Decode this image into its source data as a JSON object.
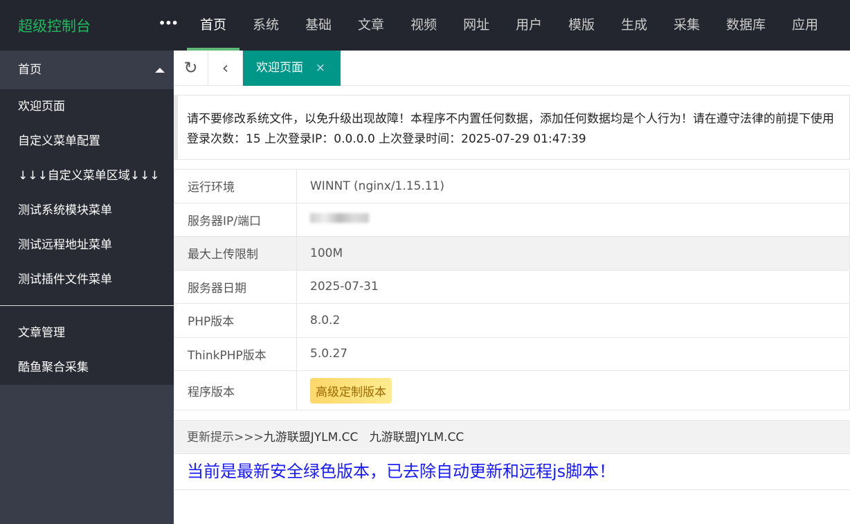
{
  "header": {
    "logo": "超级控制台",
    "more": "•••",
    "nav": [
      "首页",
      "系统",
      "基础",
      "文章",
      "视频",
      "网址",
      "用户",
      "模版",
      "生成",
      "采集",
      "数据库",
      "应用"
    ]
  },
  "sidebar": {
    "section": "首页",
    "items": [
      "欢迎页面",
      "自定义菜单配置",
      "↓↓↓自定义菜单区域↓↓↓",
      "测试系统模块菜单",
      "测试远程地址菜单",
      "测试插件文件菜单"
    ],
    "items2": [
      "文章管理",
      "酷鱼聚合采集"
    ]
  },
  "tabs": {
    "active": "欢迎页面",
    "close": "×"
  },
  "notice": {
    "line1": "请不要修改系统文件，以免升级出现故障！本程序不内置任何数据，添加任何数据均是个人行为！请在遵守法律的前提下使用",
    "line2": "登录次数：15 上次登录IP：0.0.0.0 上次登录时间：2025-07-29 01:47:39"
  },
  "info": [
    {
      "k": "运行环境",
      "v": "WINNT (nginx/1.15.11)"
    },
    {
      "k": "服务器IP/端口",
      "v": ""
    },
    {
      "k": "最大上传限制",
      "v": "100M"
    },
    {
      "k": "服务器日期",
      "v": "2025-07-31"
    },
    {
      "k": "PHP版本",
      "v": "8.0.2"
    },
    {
      "k": "ThinkPHP版本",
      "v": "5.0.27"
    },
    {
      "k": "程序版本",
      "v": "高级定制版本"
    }
  ],
  "update": {
    "label": "更新提示>>>",
    "text": "九游联盟JYLM.CC   九游联盟JYLM.CC"
  },
  "message": "当前是最新安全绿色版本，已去除自动更新和远程js脚本！"
}
